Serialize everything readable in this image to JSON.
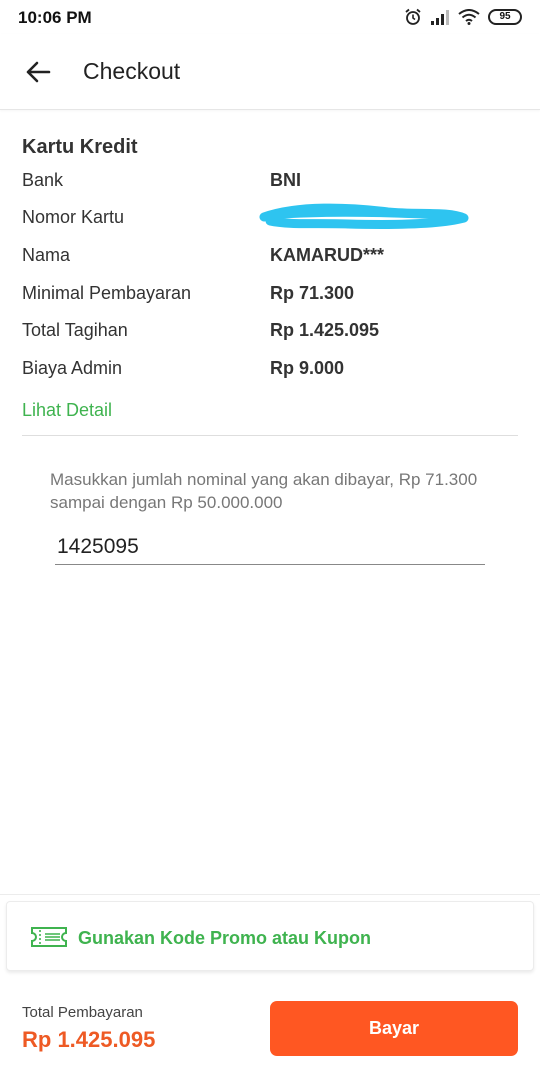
{
  "status_bar": {
    "time": "10:06 PM",
    "battery": "95",
    "icons": [
      "alarm-icon",
      "signal-icon",
      "wifi-icon",
      "battery-icon"
    ]
  },
  "header": {
    "title": "Checkout",
    "back_icon": "arrow-left-icon"
  },
  "card": {
    "section_title": "Kartu Kredit",
    "rows": [
      {
        "label": "Bank",
        "value": "BNI"
      },
      {
        "label": "Nomor Kartu",
        "value": ""
      },
      {
        "label": "Nama",
        "value": "KAMARUD***"
      },
      {
        "label": "Minimal Pembayaran",
        "value": "Rp 71.300"
      },
      {
        "label": "Total Tagihan",
        "value": "Rp 1.425.095"
      },
      {
        "label": "Biaya Admin",
        "value": "Rp 9.000"
      }
    ],
    "detail_link": "Lihat Detail"
  },
  "amount": {
    "hint": "Masukkan jumlah nominal yang akan dibayar, Rp 71.300 sampai dengan Rp 50.000.000",
    "value": "1425095"
  },
  "promo": {
    "label": "Gunakan Kode Promo atau Kupon",
    "icon": "coupon-icon"
  },
  "footer": {
    "total_label": "Total Pembayaran",
    "total_value": "Rp 1.425.095",
    "pay_label": "Bayar"
  },
  "colors": {
    "accent_green": "#3fb34f",
    "accent_orange": "#ff5722",
    "total_orange": "#ee5a24",
    "redaction_blue": "#2ec4f0"
  }
}
